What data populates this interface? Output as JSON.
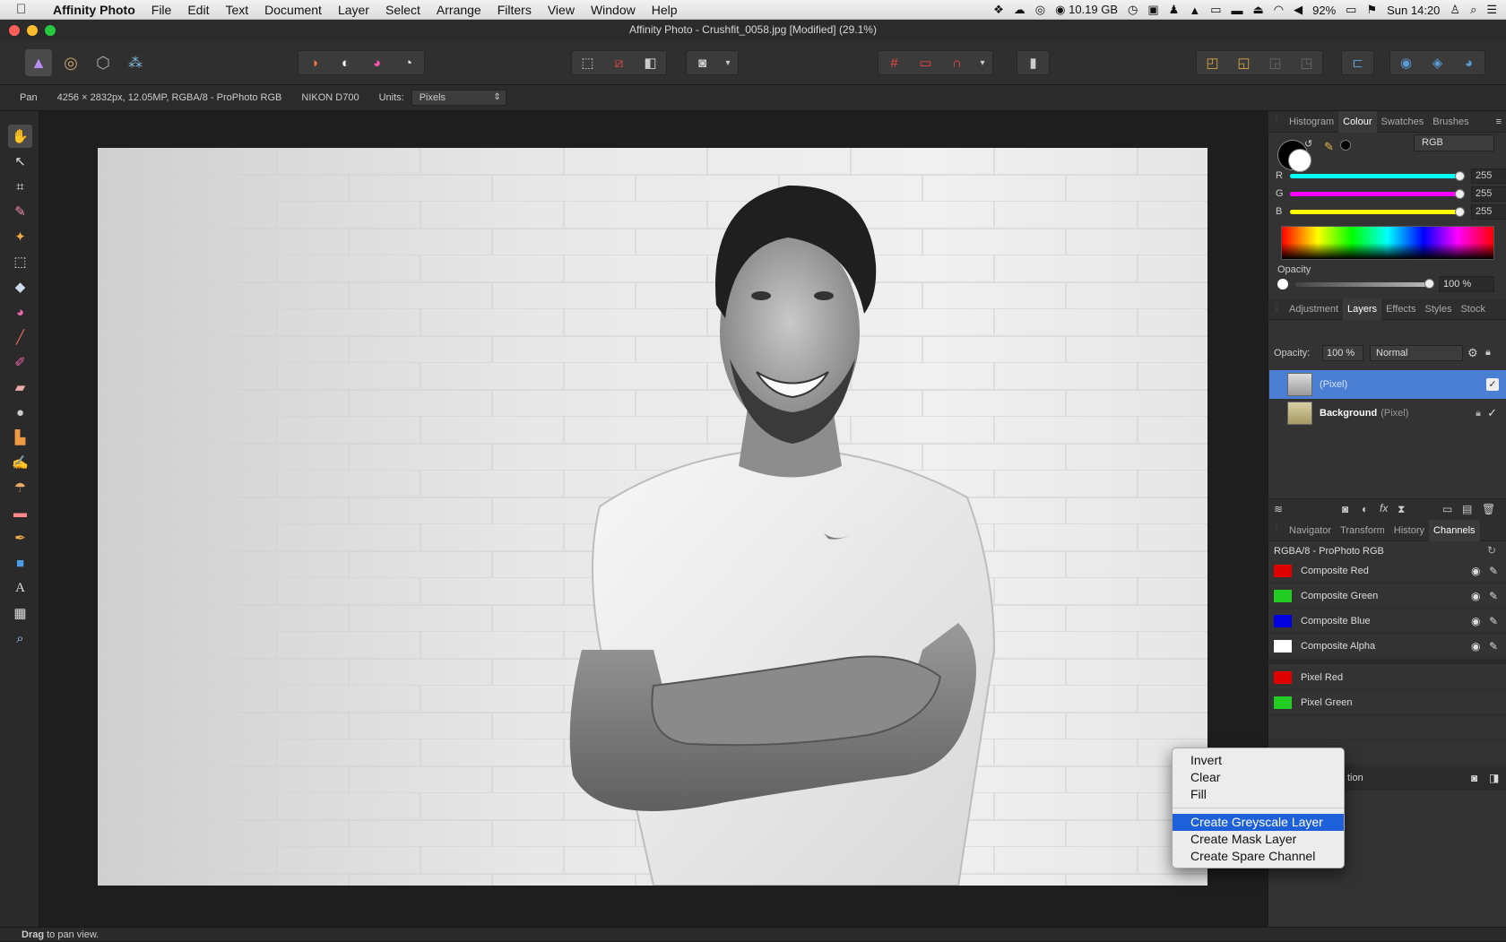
{
  "menubar": {
    "app_name": "Affinity Photo",
    "items": [
      "File",
      "Edit",
      "Text",
      "Document",
      "Layer",
      "Select",
      "Arrange",
      "Filters",
      "View",
      "Window",
      "Help"
    ],
    "memory": "10.19 GB",
    "battery": "92%",
    "clock": "Sun 14:20"
  },
  "window": {
    "title": "Affinity Photo - Crushfit_0058.jpg [Modified] (29.1%)"
  },
  "context_toolbar": {
    "tool_name": "Pan",
    "image_info": "4256 × 2832px, 12.05MP, RGBA/8 - ProPhoto RGB",
    "camera": "NIKON D700",
    "units_label": "Units:",
    "units_value": "Pixels"
  },
  "colour_panel": {
    "tabs": [
      "Histogram",
      "Colour",
      "Swatches",
      "Brushes"
    ],
    "active_tab": "Colour",
    "model": "RGB",
    "channels": [
      {
        "label": "R",
        "value": "255",
        "gradient": "linear-gradient(90deg,#00ffff,#00e5ff,#00ffff)"
      },
      {
        "label": "G",
        "value": "255",
        "gradient": "linear-gradient(90deg,#ff00ff,#ff33ff,#ff00ff)"
      },
      {
        "label": "B",
        "value": "255",
        "gradient": "linear-gradient(90deg,#ffff00,#ffff33,#ffff00)"
      }
    ],
    "opacity_label": "Opacity",
    "opacity_value": "100 %"
  },
  "layers_panel": {
    "tabs": [
      "Adjustment",
      "Layers",
      "Effects",
      "Styles",
      "Stock"
    ],
    "active_tab": "Layers",
    "opacity_label": "Opacity:",
    "opacity_value": "100 %",
    "blend_mode": "Normal",
    "layers": [
      {
        "name": "",
        "type": "(Pixel)",
        "selected": true,
        "locked": false
      },
      {
        "name": "Background",
        "type": "(Pixel)",
        "selected": false,
        "locked": true
      }
    ]
  },
  "channels_panel": {
    "tabs": [
      "Navigator",
      "Transform",
      "History",
      "Channels"
    ],
    "active_tab": "Channels",
    "header": "RGBA/8 - ProPhoto RGB",
    "channels": [
      {
        "label": "Composite Red",
        "color": "#e00000"
      },
      {
        "label": "Composite Green",
        "color": "#22cc22"
      },
      {
        "label": "Composite Blue",
        "color": "#0000e0"
      },
      {
        "label": "Composite Alpha",
        "color": "#ffffff"
      }
    ],
    "pixel_channels": [
      {
        "label": "Pixel Red",
        "color": "#e00000"
      },
      {
        "label": "Pixel Green",
        "color": "#22cc22"
      }
    ],
    "partial_row_text": "tion"
  },
  "context_menu": {
    "items": [
      {
        "label": "Invert",
        "highlighted": false
      },
      {
        "label": "Clear",
        "highlighted": false
      },
      {
        "label": "Fill",
        "highlighted": false
      },
      {
        "label": "Create Greyscale Layer",
        "highlighted": true
      },
      {
        "label": "Create Mask Layer",
        "highlighted": false
      },
      {
        "label": "Create Spare Channel",
        "highlighted": false
      }
    ]
  },
  "status_bar": {
    "bold": "Drag",
    "text": " to pan view."
  },
  "colors": {
    "selection": "#4a7fd4",
    "menu_highlight": "#1e60d9",
    "panel_bg": "#333333"
  }
}
